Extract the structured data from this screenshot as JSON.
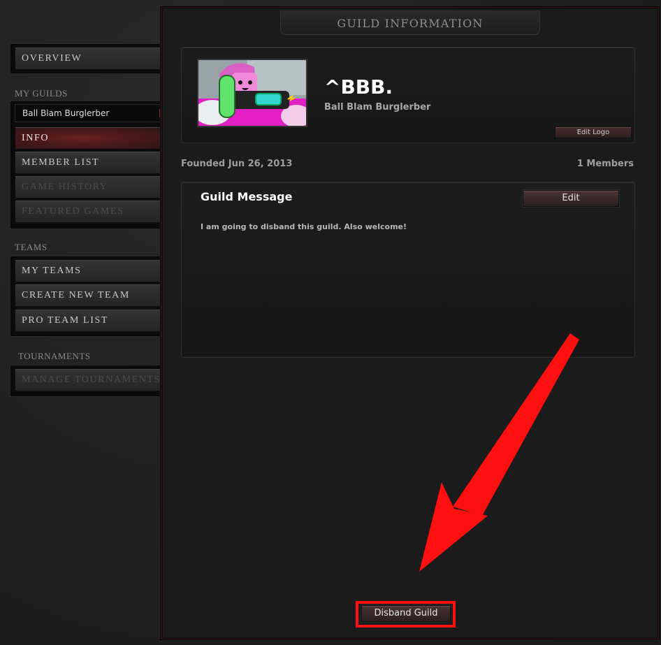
{
  "sidebar": {
    "overview_label": "OVERVIEW",
    "my_guilds_header": "MY GUILDS",
    "selected_guild": "Ball Blam Burglerber",
    "guild_items": [
      {
        "label": "INFO",
        "state": "active"
      },
      {
        "label": "MEMBER LIST",
        "state": "normal"
      },
      {
        "label": "GAME HISTORY",
        "state": "disabled"
      },
      {
        "label": "FEATURED GAMES",
        "state": "disabled"
      }
    ],
    "teams_header": "TEAMS",
    "team_items": [
      {
        "label": "MY TEAMS"
      },
      {
        "label": "CREATE NEW TEAM"
      },
      {
        "label": "PRO TEAM LIST"
      }
    ],
    "tournaments_header": "TOURNAMENTS",
    "manage_tournaments_label": "MANAGE TOURNAMENTS"
  },
  "main": {
    "title": "GUILD INFORMATION",
    "guild_tag": "^BBB.",
    "guild_name": "Ball Blam Burglerber",
    "edit_logo_label": "Edit Logo",
    "founded": "Founded Jun 26, 2013",
    "members": "1 Members",
    "message": {
      "title": "Guild Message",
      "edit_label": "Edit",
      "body": "I am going to disband this guild. Also welcome!"
    },
    "disband_label": "Disband Guild"
  },
  "colors": {
    "accent_red": "#8a2f2f",
    "annotation_red": "#ff1010",
    "logo_magenta": "#e21fc4",
    "logo_character_pink": "#f08ad8"
  },
  "icons": {
    "guild_select_arrow": "triangle-right-icon",
    "annotation": "red-arrow-annotation"
  }
}
